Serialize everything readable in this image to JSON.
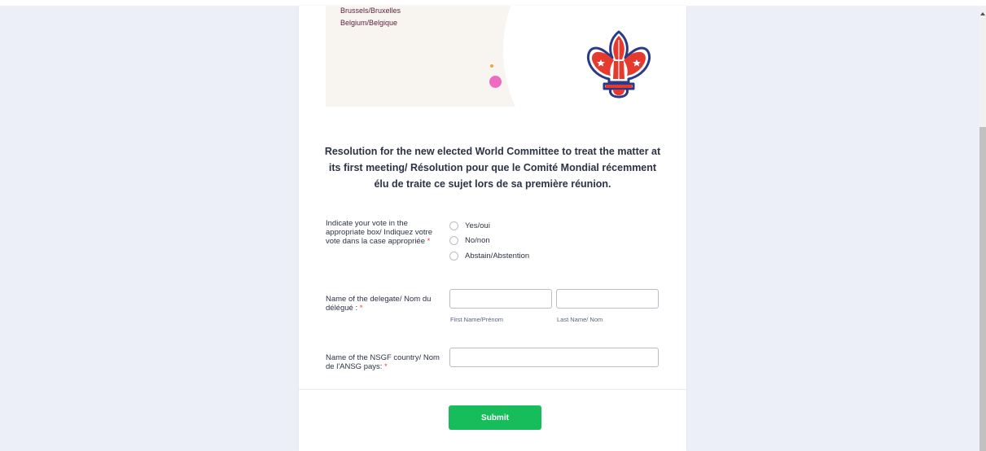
{
  "header": {
    "address_line1": "Brussels/Bruxelles",
    "address_line2": "Belgium/Belgique"
  },
  "form": {
    "title": "Resolution for the new elected World Committee to treat the matter at its first meeting/ Résolution pour que le Comité Mondial récemment élu de traite ce sujet lors de sa première réunion.",
    "vote": {
      "label": "Indicate your vote in the appropriate box/ Indiquez votre vote dans la case appropriée",
      "required_mark": "*",
      "options": [
        "Yes/oui",
        "No/non",
        "Abstain/Abstention"
      ]
    },
    "delegate": {
      "label": "Name of the delegate/ Nom du délégué :",
      "required_mark": "*",
      "first_value": "",
      "last_value": "",
      "first_sublabel": "First Name/Prénom",
      "last_sublabel": "Last Name/ Nom"
    },
    "country": {
      "label": "Name of the NSGF country/ Nom de l'ANSG pays:",
      "required_mark": "*",
      "value": ""
    },
    "submit_label": "Submit"
  },
  "colors": {
    "page_bg": "#eceff8",
    "submit_green": "#18bd5b",
    "required_red": "#f23a3c",
    "logo_red": "#e63a2e",
    "logo_blue": "#2a3a86"
  },
  "icons": {
    "logo": "fleur-de-lis-logo",
    "radio": "radio-circle"
  }
}
